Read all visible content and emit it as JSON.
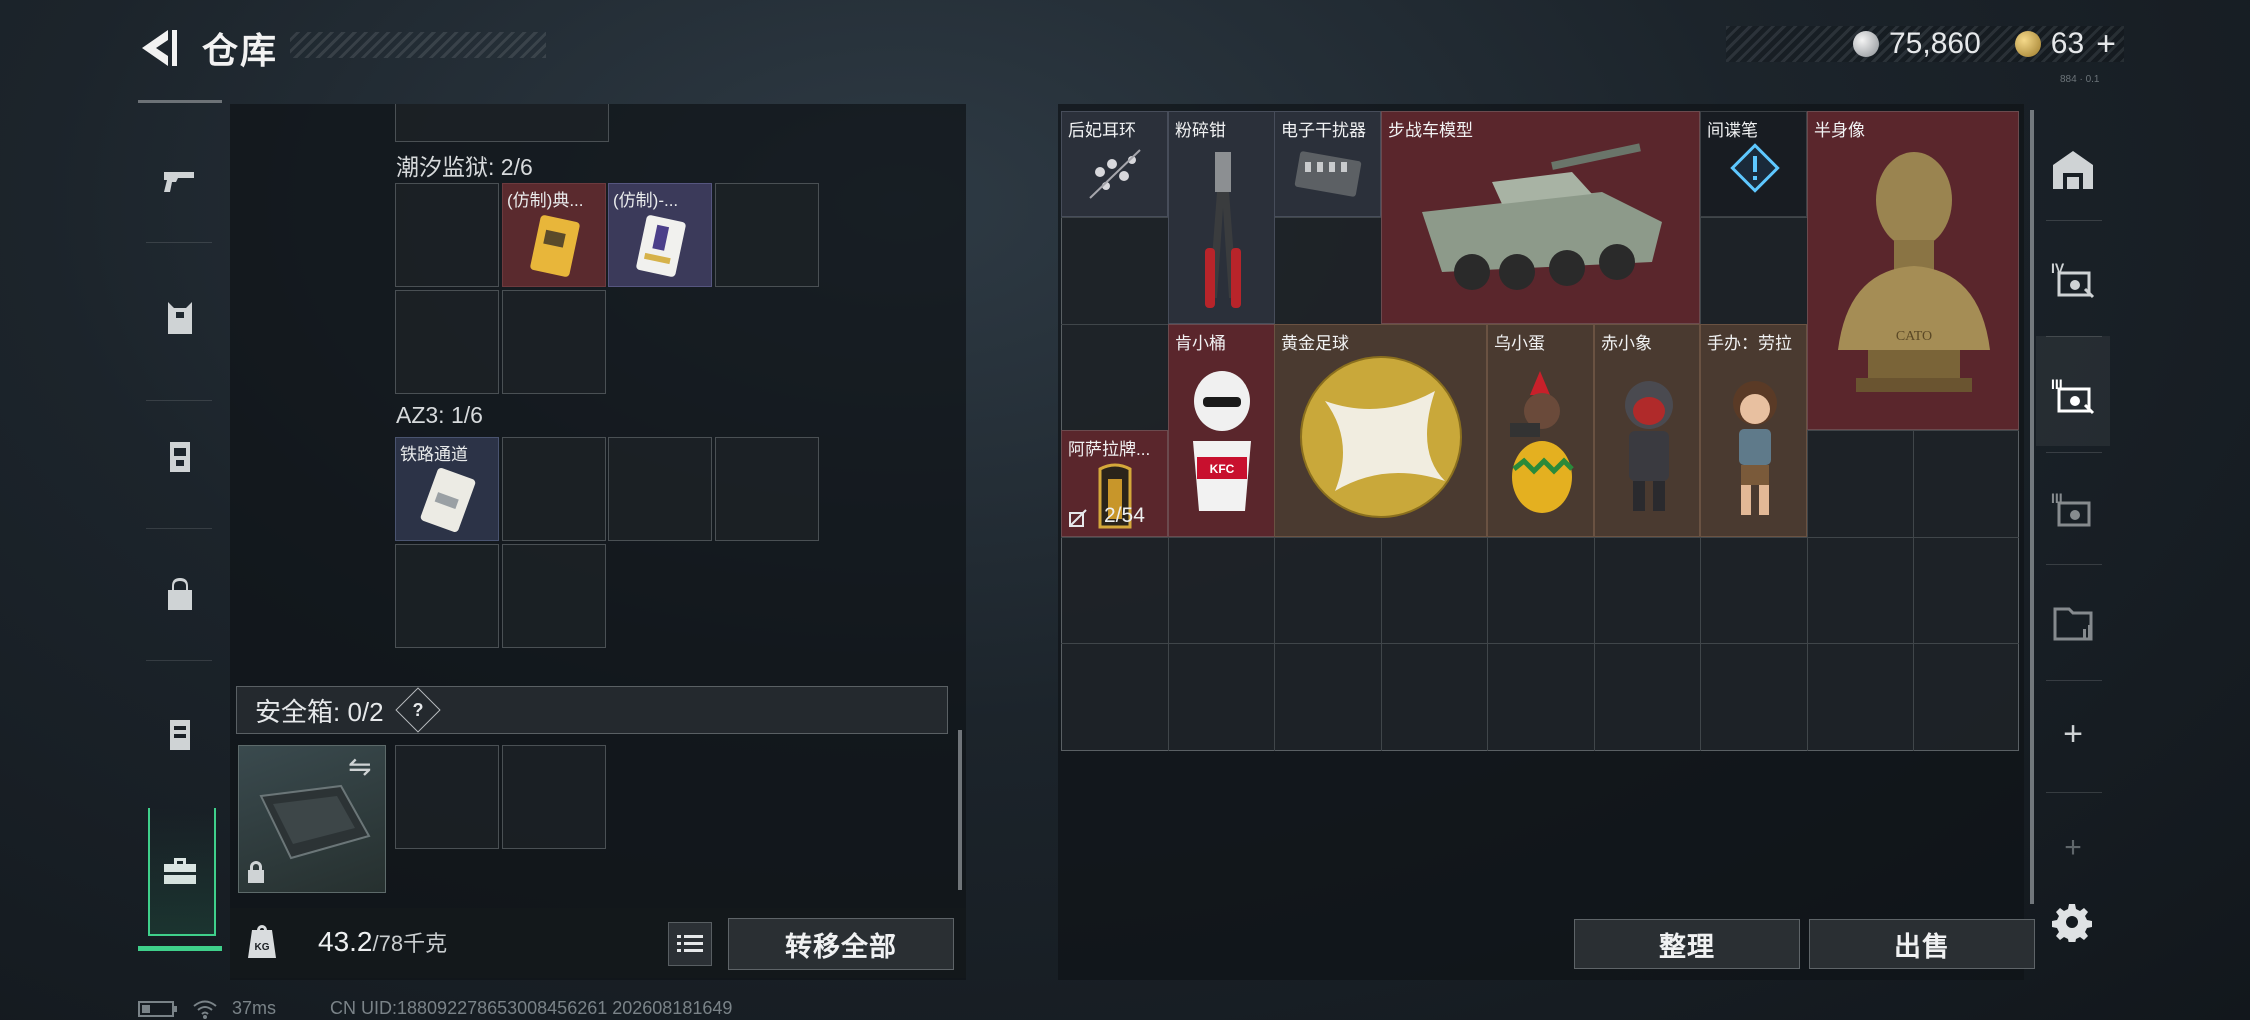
{
  "header": {
    "title": "仓库"
  },
  "currency": {
    "silver": "75,860",
    "gold": "63",
    "plus": "+",
    "tiny": "884 · 0.1"
  },
  "left_panel": {
    "sections": [
      {
        "label": "潮汐监狱: 2/6",
        "items": [
          {
            "name": "(仿制)典..."
          },
          {
            "name": "(仿制)-..."
          }
        ]
      },
      {
        "label": "AZ3: 1/6",
        "items": [
          {
            "name": "铁路通道"
          }
        ]
      }
    ],
    "safe_box": {
      "label": "安全箱: 0/2",
      "help": "?"
    },
    "weight": {
      "current": "43.2",
      "max": "/78千克"
    },
    "buttons": {
      "transfer_all": "转移全部"
    }
  },
  "right_panel": {
    "items": [
      {
        "name": "后妃耳环"
      },
      {
        "name": "粉碎钳"
      },
      {
        "name": "电子干扰器"
      },
      {
        "name": "步战车模型"
      },
      {
        "name": "间谍笔"
      },
      {
        "name": "半身像",
        "text": "CATO"
      },
      {
        "name": "肯小桶",
        "text": "KFC"
      },
      {
        "name": "黄金足球"
      },
      {
        "name": "乌小蛋"
      },
      {
        "name": "赤小象"
      },
      {
        "name": "手办：劳拉"
      },
      {
        "name": "阿萨拉牌..."
      }
    ],
    "stack_count": "2/54",
    "buttons": {
      "organize": "整理",
      "sell": "出售"
    },
    "plus": "+"
  },
  "status_bar": {
    "ping": "37ms",
    "uid": "CN UID:188092278653008456261  202608181649"
  },
  "colors": {
    "accent": "#3fd08b",
    "rare_red": "#5a262c",
    "gold_tier": "#4a3a30"
  }
}
